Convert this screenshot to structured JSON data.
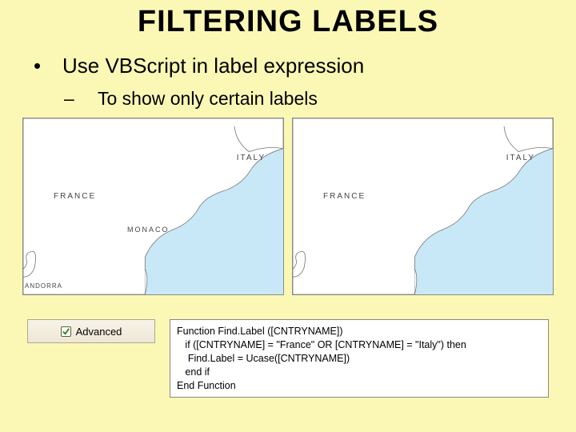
{
  "title": "FILTERING LABELS",
  "bullet1": "Use VBScript in label expression",
  "bullet2": "To show only certain labels",
  "maps": {
    "left": {
      "italy": "ITALY",
      "france": "FRANCE",
      "monaco": "MONACO",
      "andorra": "ANDORRA"
    },
    "right": {
      "italy": "ITALY",
      "france": "FRANCE"
    }
  },
  "advanced": {
    "label": "Advanced"
  },
  "code": {
    "l1": "Function Find.Label ([CNTRYNAME])",
    "l2": "   if ([CNTRYNAME] = \"France\" OR [CNTRYNAME] = \"Italy\") then",
    "l3": "    Find.Label = Ucase([CNTRYNAME])",
    "l4": "   end if",
    "l5": "End Function"
  }
}
